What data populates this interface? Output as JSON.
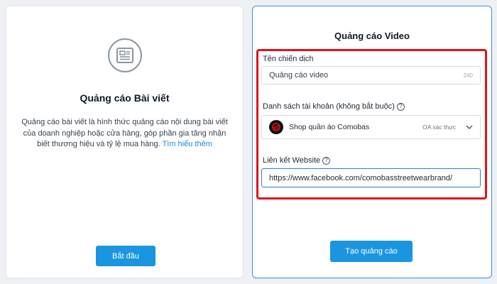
{
  "left_card": {
    "title": "Quảng cáo Bài viết",
    "description": "Quảng cáo bài viết là hình thức quảng cáo nội dung bài viết của doanh nghiệp hoặc cửa hàng, góp phần gia tăng nhận biết thương hiệu và tỷ lệ mua hàng.",
    "learn_more": "Tìm hiểu thêm",
    "button": "Bắt đầu",
    "icon": "article-icon"
  },
  "right_card": {
    "title": "Quảng cáo Video",
    "campaign_label": "Tên chiến dịch",
    "campaign_value": "Quảng cáo video",
    "campaign_char_count": "240",
    "account_label": "Danh sách tài khoản (không bắt buộc)",
    "account_name": "Shop quần áo Comobas",
    "account_status": "OA xác thực",
    "website_label": "Liên kết Website",
    "website_value": "https://www.facebook.com/comobasstreetwearbrand/",
    "button": "Tạo quảng cáo"
  },
  "colors": {
    "accent": "#1a95e0",
    "highlight": "#e0121b",
    "background": "#eef0f3"
  }
}
